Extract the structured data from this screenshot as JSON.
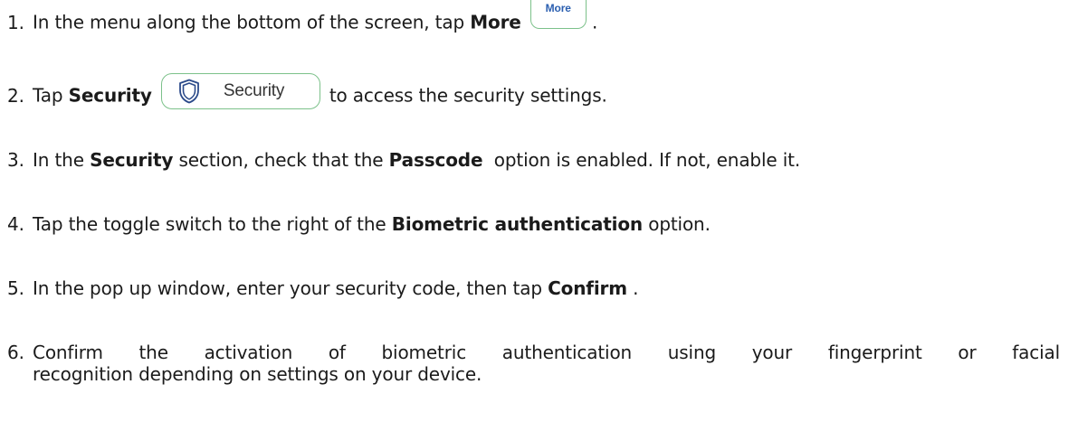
{
  "steps": [
    {
      "num": "1.",
      "text_before": "In the menu along the bottom of the screen, tap ",
      "bold": "More",
      "button_label": "More",
      "text_after": "."
    },
    {
      "num": "2.",
      "text_before": "Tap ",
      "bold": "Security",
      "button_label": "Security",
      "text_after": "to access the security settings."
    },
    {
      "num": "3.",
      "text_before": "In the ",
      "bold1": "Security",
      "text_mid": " section, check that the ",
      "bold2": "Passcode",
      "text_after": "  option is enabled. If not, enable it."
    },
    {
      "num": "4.",
      "text_before": "Tap the toggle switch to the right of the ",
      "bold": "Biometric authentication",
      "text_after": " option."
    },
    {
      "num": "5.",
      "text_before": "In the pop up window, enter your security code, then tap ",
      "bold": "Confirm",
      "text_after": " ."
    },
    {
      "num": "6.",
      "line1": "Confirm the activation of biometric authentication using your fingerprint or facial",
      "line2": "recognition depending on settings on your device."
    }
  ],
  "icons": {
    "more_button": "more-tab-icon",
    "security_button": "shield-icon"
  },
  "colors": {
    "button_border": "#7cc18a",
    "more_label": "#2b5fb0",
    "shield": "#2b4a8a"
  }
}
